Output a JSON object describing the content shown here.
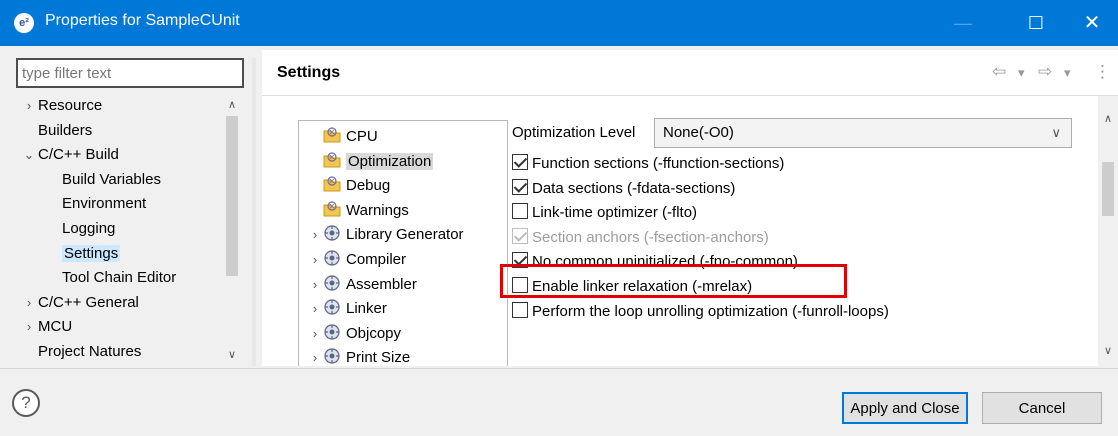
{
  "window": {
    "title": "Properties for SampleCUnit",
    "app_icon_text": "e²",
    "minimize_glyph": "—",
    "maximize_glyph": "☐",
    "close_glyph": "✕"
  },
  "filter": {
    "placeholder": "type filter text"
  },
  "left_tree": [
    {
      "label": "Resource",
      "twisty": "›",
      "indent": 0,
      "selected": false
    },
    {
      "label": "Builders",
      "twisty": "",
      "indent": 0,
      "selected": false
    },
    {
      "label": "C/C++ Build",
      "twisty": "⌄",
      "indent": 0,
      "selected": false
    },
    {
      "label": "Build Variables",
      "twisty": "",
      "indent": 1,
      "selected": false
    },
    {
      "label": "Environment",
      "twisty": "",
      "indent": 1,
      "selected": false
    },
    {
      "label": "Logging",
      "twisty": "",
      "indent": 1,
      "selected": false
    },
    {
      "label": "Settings",
      "twisty": "",
      "indent": 1,
      "selected": true
    },
    {
      "label": "Tool Chain Editor",
      "twisty": "",
      "indent": 1,
      "selected": false
    },
    {
      "label": "C/C++ General",
      "twisty": "›",
      "indent": 0,
      "selected": false
    },
    {
      "label": "MCU",
      "twisty": "›",
      "indent": 0,
      "selected": false
    },
    {
      "label": "Project Natures",
      "twisty": "",
      "indent": 0,
      "selected": false
    }
  ],
  "right_header": {
    "title": "Settings",
    "nav_back": "⇦",
    "nav_back_menu": "▾",
    "nav_forward": "⇨",
    "nav_forward_menu": "▾",
    "view_menu": "⋮"
  },
  "tool_tree": [
    {
      "label": "CPU",
      "twisty": "",
      "kind": "folder",
      "selected": false
    },
    {
      "label": "Optimization",
      "twisty": "",
      "kind": "folder",
      "selected": true
    },
    {
      "label": "Debug",
      "twisty": "",
      "kind": "folder",
      "selected": false
    },
    {
      "label": "Warnings",
      "twisty": "",
      "kind": "folder",
      "selected": false
    },
    {
      "label": "Library Generator",
      "twisty": "›",
      "kind": "gear",
      "selected": false
    },
    {
      "label": "Compiler",
      "twisty": "›",
      "kind": "gear",
      "selected": false
    },
    {
      "label": "Assembler",
      "twisty": "›",
      "kind": "gear",
      "selected": false
    },
    {
      "label": "Linker",
      "twisty": "›",
      "kind": "gear",
      "selected": false
    },
    {
      "label": "Objcopy",
      "twisty": "›",
      "kind": "gear",
      "selected": false
    },
    {
      "label": "Print Size",
      "twisty": "›",
      "kind": "gear",
      "selected": false
    }
  ],
  "optimization": {
    "level_label": "Optimization Level",
    "level_value": "None(-O0)",
    "options": [
      {
        "label": "Function sections (-ffunction-sections)",
        "checked": true,
        "disabled": false
      },
      {
        "label": "Data sections (-fdata-sections)",
        "checked": true,
        "disabled": false
      },
      {
        "label": "Link-time optimizer (-flto)",
        "checked": false,
        "disabled": false
      },
      {
        "label": "Section anchors (-fsection-anchors)",
        "checked": true,
        "disabled": true
      },
      {
        "label": "No common uninitialized (-fno-common)",
        "checked": true,
        "disabled": false
      },
      {
        "label": "Enable linker relaxation (-mrelax)",
        "checked": false,
        "disabled": false
      },
      {
        "label": "Perform the loop unrolling optimization (-funroll-loops)",
        "checked": false,
        "disabled": false
      }
    ]
  },
  "buttons": {
    "help": "?",
    "apply": "Apply and Close",
    "cancel": "Cancel"
  },
  "colors": {
    "titlebar": "#0078d7",
    "highlight": "#e00000",
    "selection": "#cce8ff"
  }
}
